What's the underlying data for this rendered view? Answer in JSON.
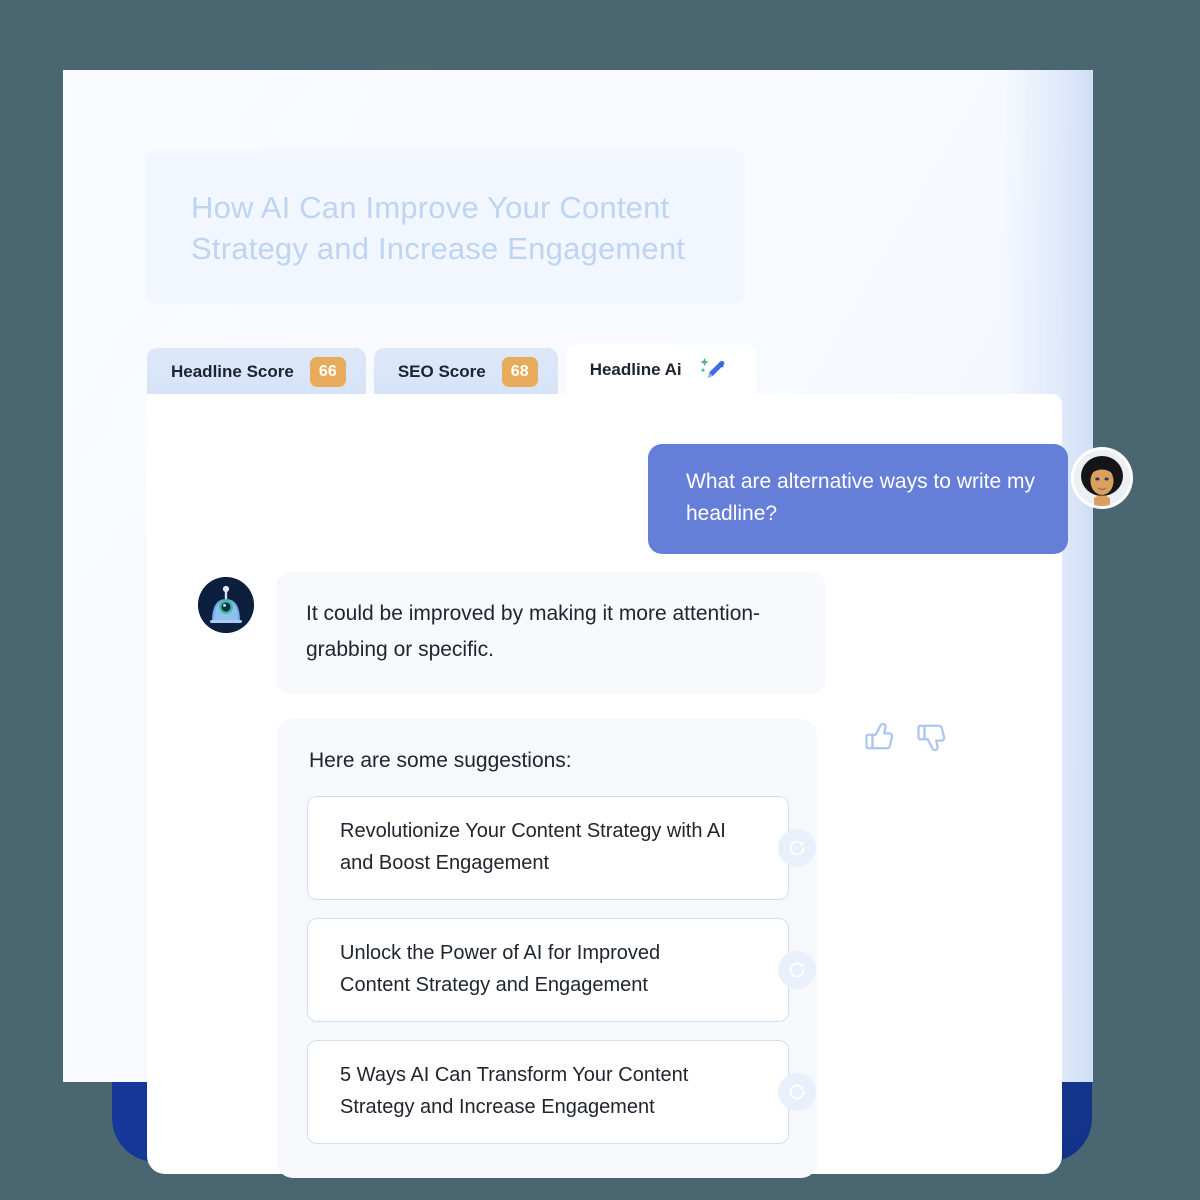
{
  "background_color": "#4a6671",
  "accent_color": "#1a3f9e",
  "document": {
    "headline": "How AI Can Improve Your Content\nStrategy and Increase Engagement"
  },
  "tabs": [
    {
      "label": "Headline Score",
      "score": "66",
      "icon": null,
      "active": false
    },
    {
      "label": "SEO Score",
      "score": "68",
      "icon": null,
      "active": false
    },
    {
      "label": "Headline Ai",
      "score": null,
      "icon": "magic-wand-icon",
      "active": true
    }
  ],
  "chat": {
    "user_message": "What are alternative ways to write my headline?",
    "user_avatar_name": "user-avatar",
    "ai_message": "It could be improved by making it more attention-grabbing or specific.",
    "ai_avatar_name": "ai-bot-avatar",
    "feedback": {
      "thumbs_up": "thumbs-up-icon",
      "thumbs_down": "thumbs-down-icon"
    }
  },
  "suggestions": {
    "title": "Here are some suggestions:",
    "items": [
      {
        "text": "Revolutionize Your Content Strategy with AI and Boost Engagement",
        "action": "regenerate"
      },
      {
        "text": "Unlock the Power of AI for Improved Content Strategy and Engagement",
        "action": "regenerate"
      },
      {
        "text": "5 Ways AI Can Transform Your Content Strategy and Increase Engagement",
        "action": "regenerate"
      }
    ]
  },
  "colors": {
    "user_bubble": "#657fd8",
    "ai_bubble": "#f7f9fc",
    "badge": "#e8ab5c",
    "tab_inactive": "#d9e5f8",
    "tab_active": "#ffffff",
    "suggestion_border": "#cfe0f5",
    "headline_text": "#bed4f3"
  }
}
